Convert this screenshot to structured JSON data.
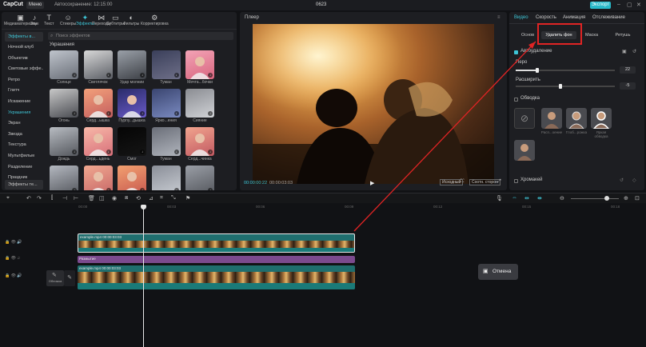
{
  "topbar": {
    "logo": "CapCut",
    "menu": "Меню",
    "autosave": "Автосохранение: 12:15:00",
    "project_name": "0623",
    "export": "Экспорт"
  },
  "toolbar": {
    "items": [
      {
        "label": "Медиаматериалы",
        "icon": "▣"
      },
      {
        "label": "Звук",
        "icon": "♪"
      },
      {
        "label": "Текст",
        "icon": "T"
      },
      {
        "label": "Стикеры",
        "icon": "☺"
      },
      {
        "label": "Эффекты",
        "icon": "✦"
      },
      {
        "label": "Переходы",
        "icon": "⋈"
      },
      {
        "label": "Субтитры",
        "icon": "▭"
      },
      {
        "label": "Фильтры",
        "icon": "◐"
      },
      {
        "label": "Корректировка",
        "icon": "⚙"
      }
    ]
  },
  "categories": {
    "dropdown": "Эффекты в...",
    "items": [
      "Ночной клуб",
      "Объектив",
      "Световые эффе...",
      "Ретро",
      "Глитч",
      "Искажение",
      "Украшения",
      "Экран",
      "Звезда",
      "Текстура",
      "Мультфильм",
      "Разделение",
      "Праздник"
    ],
    "selected": "Украшения",
    "bottom_dropdown": "Эффекты те..."
  },
  "search": {
    "placeholder": "Поиск эффектов"
  },
  "group_label": "Украшения",
  "effects": [
    "Солнце",
    "Светлячок",
    "Удар молнии",
    "Туман",
    "Мечта...бочки",
    "Огонь",
    "Серд...ышка",
    "Пурпу...дышка",
    "Ярко...ения",
    "Сияние",
    "Дождь",
    "Серд...ьдень",
    "Смог",
    "Туман",
    "Серд...чинка",
    "",
    "",
    "",
    "",
    ""
  ],
  "player": {
    "title": "Плеер",
    "current_time": "00:00:00:22",
    "duration": "00:00:03:03",
    "original": "Исходный",
    "ratio": "Соотн. сторон"
  },
  "right_panel": {
    "tabs": [
      "Видео",
      "Скорость",
      "Анимация",
      "Отслеживание"
    ],
    "active_tab": "Видео",
    "subtabs": [
      "Основ",
      "Удалить фон",
      "Маска",
      "Ретушь"
    ],
    "active_subtab": "Удалить фон",
    "auto_remove": "Автоудаление",
    "feather_label": "Перо",
    "feather_value": "22",
    "feather_pct": 0.22,
    "expand_label": "Расширить",
    "expand_value": "-5",
    "expand_pct": 0.45,
    "stroke_label": "Обводка",
    "stroke_options": [
      "",
      "Расп...оение",
      "Глоб...рожка",
      "Яркая обводка",
      ""
    ],
    "chroma_label": "Хромакей"
  },
  "timeline": {
    "ticks": [
      "00:00",
      "00:03",
      "00:06",
      "00:09",
      "00:12",
      "00:15",
      "00:18"
    ],
    "clip1_name": "example.mp4   00:00:03:03",
    "effect_name": "Размытие",
    "clip2_name": "example.mp4   00:00:03:03",
    "cover_label": "Обложка",
    "cancel": "Отмена"
  },
  "colors": {
    "accent": "#3ec6d7",
    "highlight": "#e02424",
    "effect_bar": "#7b4a8e"
  }
}
